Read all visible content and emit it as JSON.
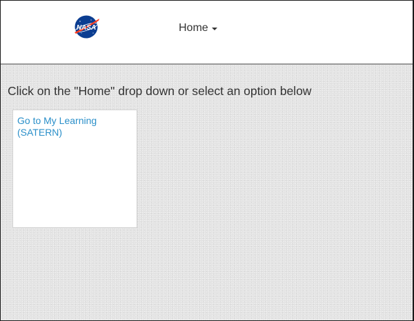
{
  "navbar": {
    "logo_text": "NASA",
    "home_menu_label": "Home"
  },
  "main": {
    "instructions": "Click on the \"Home\" drop down or select an option below",
    "tiles": [
      {
        "label": "Go to My Learning (SATERN)"
      }
    ]
  },
  "colors": {
    "link": "#2a8fc9",
    "background": "#e3e3e3",
    "nasa_blue": "#0b3d91",
    "nasa_red": "#fc3d21"
  }
}
